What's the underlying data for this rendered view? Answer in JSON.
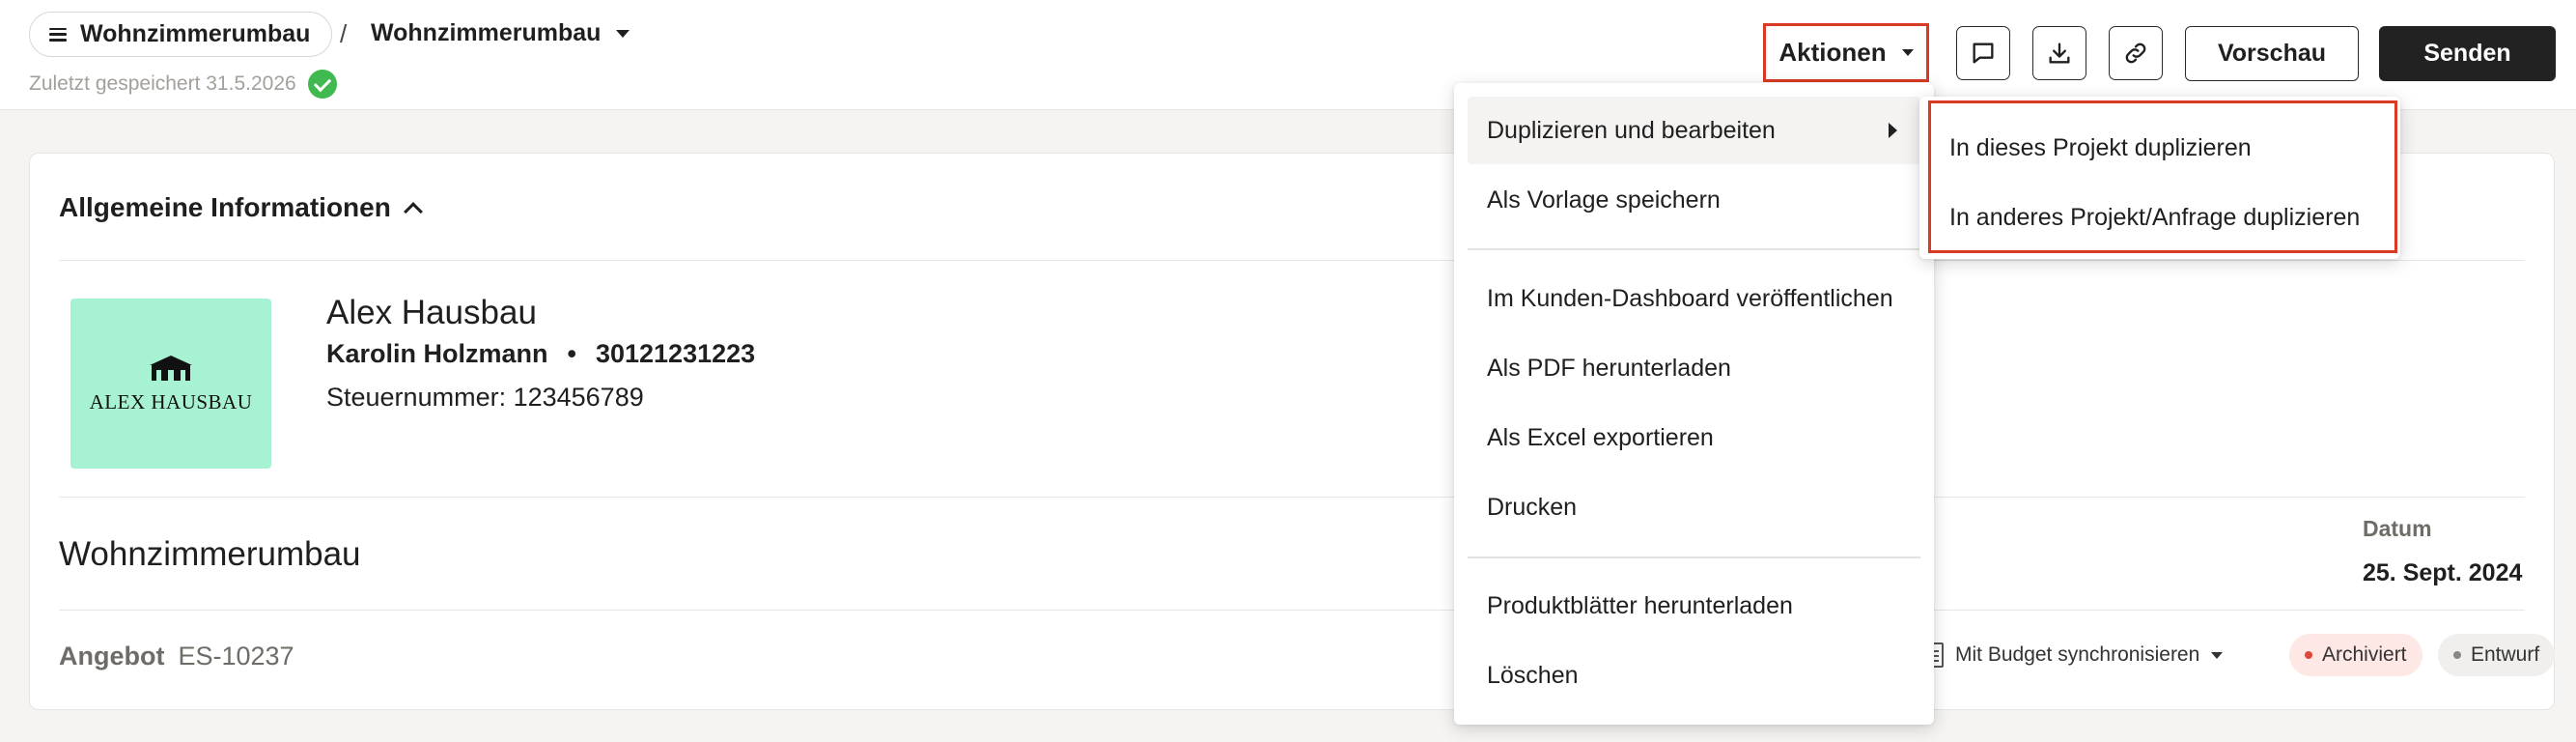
{
  "header": {
    "project_name": "Wohnzimmerumbau",
    "breadcrumb_separator": "/",
    "current_page": "Wohnzimmerumbau",
    "saved_status": "Zuletzt gespeichert 31.5.2026",
    "actions_label": "Aktionen",
    "icons": [
      "comment-icon",
      "download-icon",
      "link-icon"
    ],
    "preview_label": "Vorschau",
    "send_label": "Senden"
  },
  "card": {
    "section_title": "Allgemeine Informationen",
    "logo_text": "ALEX HAUSBAU",
    "company_name": "Alex Hausbau",
    "contact_name": "Karolin Holzmann",
    "contact_separator": "•",
    "contact_phone": "30121231223",
    "tax_number": "Steuernummer: 123456789",
    "project_title": "Wohnzimmerumbau",
    "date_label": "Datum",
    "date_value": "25. Sept. 2024",
    "offer_label": "Angebot",
    "offer_number": "ES-10237",
    "sync_label": "Mit Budget synchronisieren",
    "badges": [
      {
        "label": "Archiviert",
        "dot_color": "#e0463a"
      },
      {
        "label": "Entwurf",
        "dot_color": "#8a8782"
      }
    ]
  },
  "actions_menu": {
    "items": [
      {
        "label": "Duplizieren und bearbeiten",
        "has_submenu": true
      },
      {
        "label": "Als Vorlage speichern"
      },
      {
        "label": "Im Kunden-Dashboard veröffentlichen"
      },
      {
        "label": "Als PDF herunterladen"
      },
      {
        "label": "Als Excel exportieren"
      },
      {
        "label": "Drucken"
      },
      {
        "label": "Produktblätter herunterladen"
      },
      {
        "label": "Löschen"
      }
    ],
    "submenu": [
      {
        "label": "In dieses Projekt duplizieren"
      },
      {
        "label": "In anderes Projekt/Anfrage duplizieren"
      }
    ]
  },
  "colors": {
    "highlight": "#d93a24",
    "primary_button": "#222222",
    "success": "#3fb950",
    "logo_background": "#a6f2d3"
  }
}
